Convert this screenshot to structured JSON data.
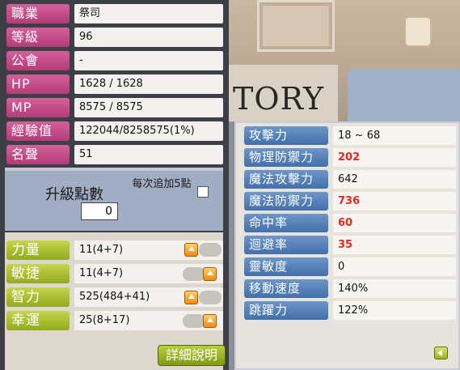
{
  "background": {
    "sign_text": "TORY"
  },
  "basic": [
    {
      "label": "職業",
      "value": "祭司"
    },
    {
      "label": "等級",
      "value": "96"
    },
    {
      "label": "公會",
      "value": "-"
    },
    {
      "label": "HP",
      "value": "1628 / 1628"
    },
    {
      "label": "MP",
      "value": "8575 / 8575"
    },
    {
      "label": "經驗值",
      "value": "122044/8258575(1%)"
    },
    {
      "label": "名聲",
      "value": "51"
    }
  ],
  "ap": {
    "label": "升級點數",
    "value": "0",
    "auto_hint": "每次追加5點"
  },
  "stats": [
    {
      "label": "力量",
      "value": "11(4+7)"
    },
    {
      "label": "敏捷",
      "value": "11(4+7)"
    },
    {
      "label": "智力",
      "value": "525(484+41)"
    },
    {
      "label": "幸運",
      "value": "25(8+17)"
    }
  ],
  "detail_button": "詳細說明",
  "detail": [
    {
      "label": "攻擊力",
      "value": "18 ~ 68",
      "highlight": false
    },
    {
      "label": "物理防禦力",
      "value": "202",
      "highlight": true
    },
    {
      "label": "魔法攻擊力",
      "value": "642",
      "highlight": false
    },
    {
      "label": "魔法防禦力",
      "value": "736",
      "highlight": true
    },
    {
      "label": "命中率",
      "value": "60",
      "highlight": true
    },
    {
      "label": "迴避率",
      "value": "35",
      "highlight": true
    },
    {
      "label": "靈敏度",
      "value": "0",
      "highlight": false
    },
    {
      "label": "移動速度",
      "value": "140%",
      "highlight": false
    },
    {
      "label": "跳躍力",
      "value": "122%",
      "highlight": false
    }
  ],
  "colors": {
    "basic_label": "#c94c8a",
    "stat_label": "#a9bd2e",
    "detail_label": "#5580b9",
    "highlight_value": "#e8271f"
  }
}
